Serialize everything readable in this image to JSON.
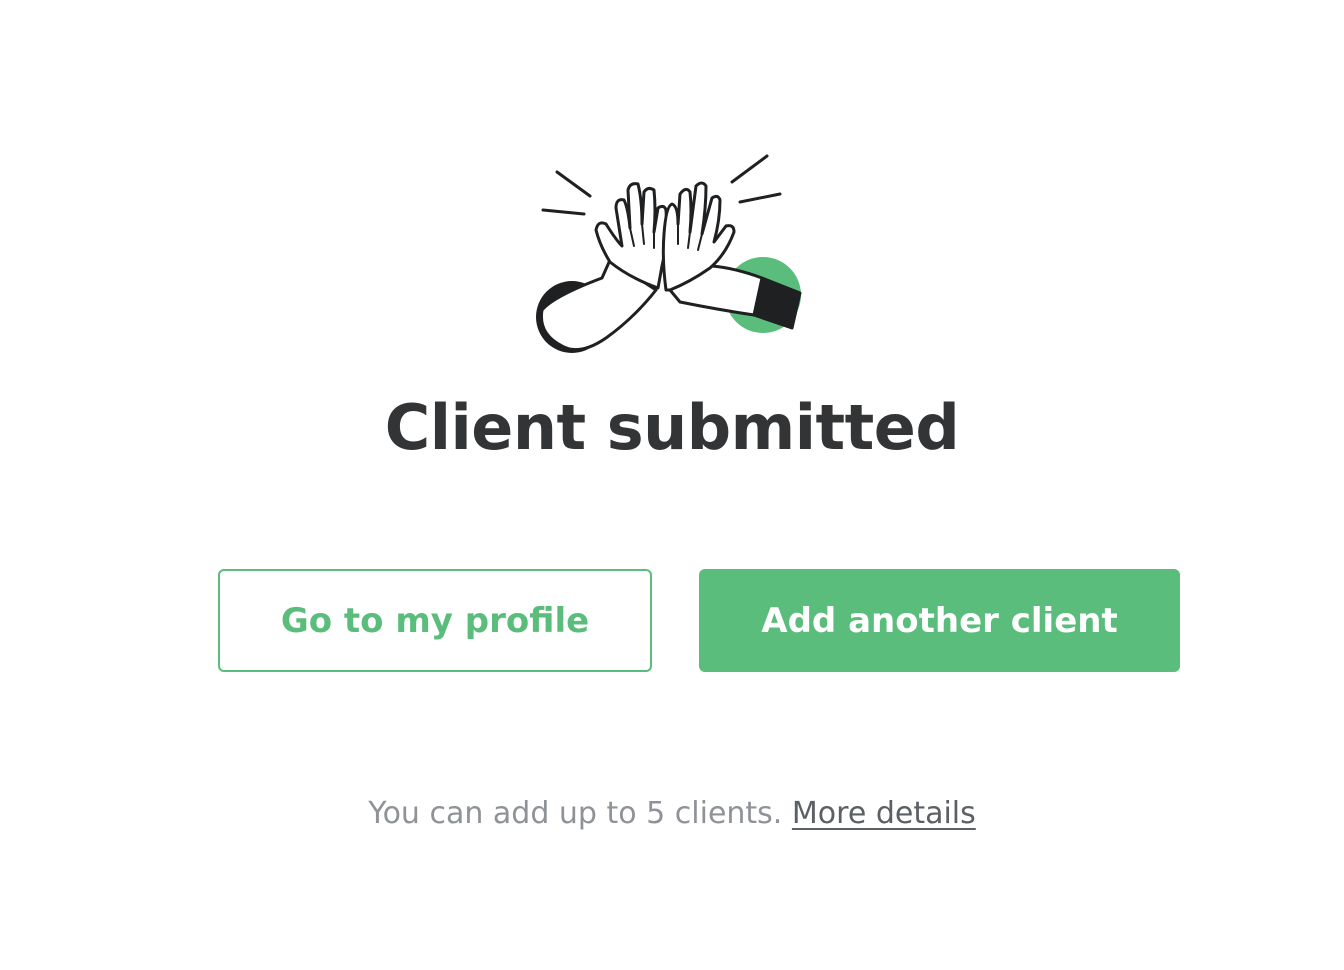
{
  "illustration": {
    "icon": "high-five-icon",
    "accent_color": "#5bbd7b",
    "ink_color": "#1f2022"
  },
  "title": "Client submitted",
  "actions": {
    "secondary_label": "Go to my profile",
    "primary_label": "Add another client"
  },
  "footnote": {
    "text": "You can add up to 5 clients.",
    "link_label": "More details"
  },
  "colors": {
    "brand_green": "#5bbd7b",
    "heading": "#333436",
    "muted_text": "#8f9399",
    "link_text": "#5c5f64"
  }
}
